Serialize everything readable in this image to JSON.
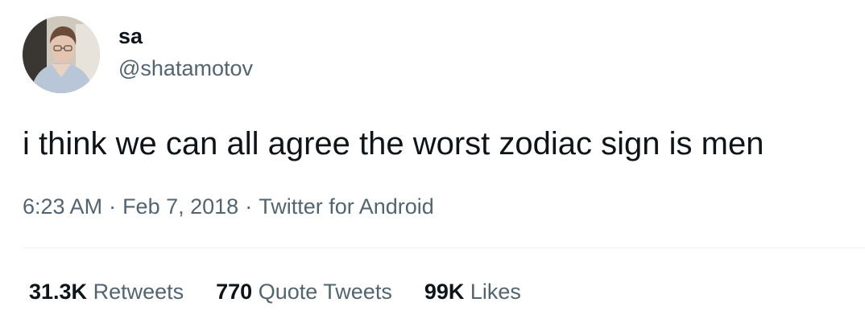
{
  "author": {
    "display_name": "sa",
    "handle": "@shatamotov"
  },
  "tweet": {
    "text": "i think we can all agree the worst zodiac sign is men",
    "time": "6:23 AM",
    "date": "Feb 7, 2018",
    "source": "Twitter for Android",
    "separator": "·"
  },
  "stats": {
    "retweets_count": "31.3K",
    "retweets_label": "Retweets",
    "quotes_count": "770",
    "quotes_label": "Quote Tweets",
    "likes_count": "99K",
    "likes_label": "Likes"
  },
  "colors": {
    "text_primary": "#0f1419",
    "text_secondary": "#536471",
    "divider": "#eff3f4"
  }
}
